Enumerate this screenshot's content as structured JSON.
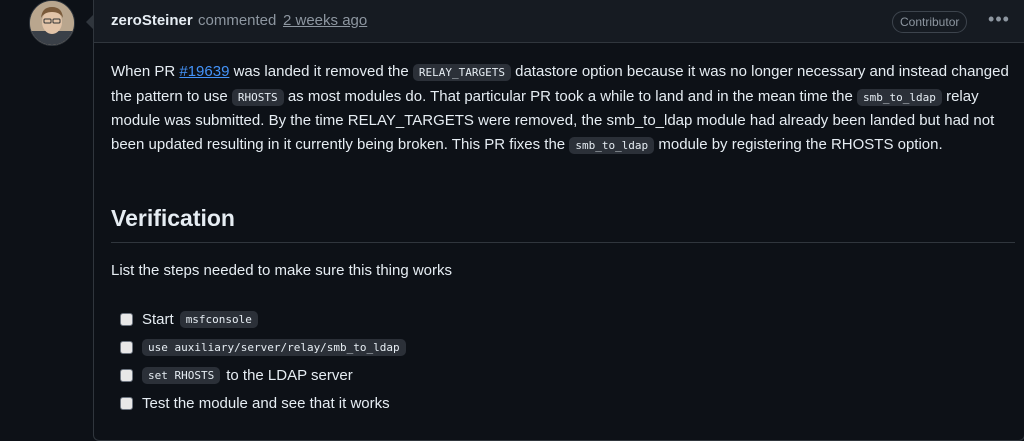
{
  "comment": {
    "author": "zeroSteiner",
    "action": "commented",
    "time": "2 weeks ago",
    "role_badge": "Contributor",
    "menu_icon": "kebab-horizontal-icon"
  },
  "body": {
    "p1": {
      "t1": "When PR ",
      "link": "#19639",
      "t2": " was landed it removed the ",
      "code1": "RELAY_TARGETS",
      "t3": " datastore option because it was no longer necessary and instead changed the pattern to use ",
      "code2": "RHOSTS",
      "t4": " as most modules do. That particular PR took a while to land and in the mean time the ",
      "code3": "smb_to_ldap",
      "t5": " relay module was submitted. By the time RELAY_TARGETS were removed, the smb_to_ldap module had already been landed but had not been updated resulting in it currently being broken. This PR fixes the ",
      "code4": "smb_to_ldap",
      "t6": " module by registering the RHOSTS option."
    },
    "heading": "Verification",
    "intro": "List the steps needed to make sure this thing works",
    "tasks": [
      {
        "before": "Start",
        "code": "msfconsole",
        "after": ""
      },
      {
        "before": "",
        "code": "use auxiliary/server/relay/smb_to_ldap",
        "after": ""
      },
      {
        "before": "",
        "code": "set RHOSTS",
        "after": "to the LDAP server"
      },
      {
        "before": "Test the module and see that it works",
        "code": "",
        "after": ""
      }
    ]
  },
  "colors": {
    "background": "#0d1117",
    "link": "#4493f8",
    "muted": "#8d96a0"
  }
}
